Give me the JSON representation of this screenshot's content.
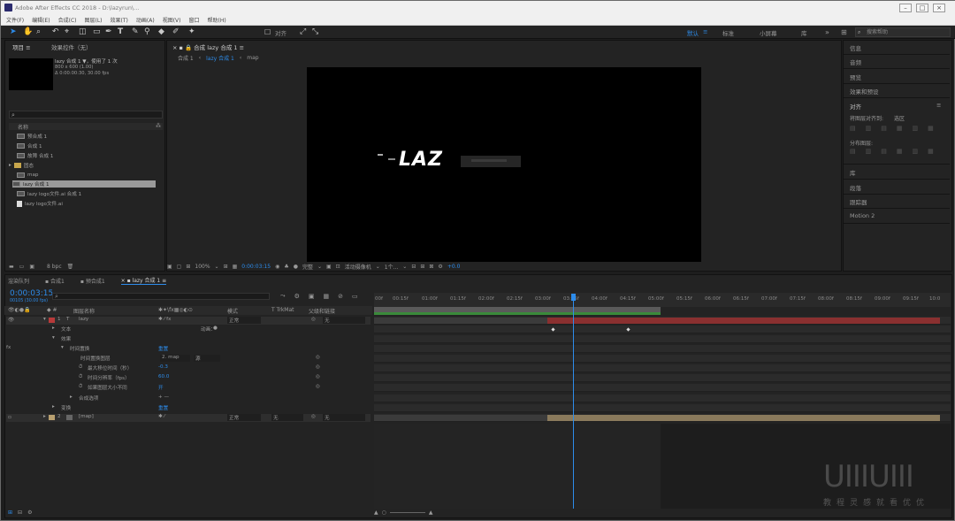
{
  "title_bar": {
    "title": "Adobe After Effects CC 2018 - D:\\lazyrun\\..."
  },
  "menu": [
    "文件(F)",
    "编辑(E)",
    "合成(C)",
    "图层(L)",
    "效果(T)",
    "动画(A)",
    "视图(V)",
    "窗口",
    "帮助(H)"
  ],
  "toolbar": {
    "snap_label": "对齐"
  },
  "workspaces": [
    "默认",
    "标准",
    "小屏幕",
    "库"
  ],
  "search_help": {
    "placeholder": "搜索帮助"
  },
  "project_panel": {
    "tab_project": "项目 ≡",
    "tab_effect_controls": "效果控件（无）",
    "comp_name": "lazy 合成 1 ▼，使用了 1 次",
    "comp_size": "800 x 600 (1.00)",
    "comp_duration": "Δ 0:00:00:30, 30.00 fps",
    "search_placeholder": "",
    "col_name": "名称",
    "items": [
      {
        "name": "预合成 1",
        "icon": "comp"
      },
      {
        "name": "合成 1",
        "icon": "comp"
      },
      {
        "name": "故障 合成 1",
        "icon": "comp"
      },
      {
        "name": "固态",
        "icon": "folder"
      },
      {
        "name": "map",
        "icon": "comp"
      },
      {
        "name": "lazy 合成 1",
        "icon": "comp",
        "selected": true
      },
      {
        "name": "lazy logo文件.ai 合成 1",
        "icon": "comp"
      },
      {
        "name": "lazy logo文件.ai",
        "icon": "file"
      }
    ],
    "bpc": "8 bpc"
  },
  "comp_viewer": {
    "tab_label": "合成 lazy 合成 1",
    "breadcrumb": [
      "合成 1",
      "lazy 合成 1",
      "map"
    ],
    "canvas_text": "LAZ",
    "zoom": "100%",
    "time": "0:00:03:15",
    "resolution": "完整",
    "camera": "活动摄像机",
    "views": "1个...",
    "exposure": "+0.0"
  },
  "right_panel": {
    "items": [
      "信息",
      "音频",
      "预览",
      "效果和预设"
    ],
    "align_title": "对齐",
    "align_to": "将图层对齐到:",
    "align_to_value": "选区",
    "distribute": "分布图层:",
    "items2": [
      "库",
      "段落",
      "跟踪器",
      "Motion 2"
    ]
  },
  "timeline": {
    "timecode": "0:00:03:15",
    "timecode_sub": "00105 (30.00 fps)",
    "tabs": [
      "渲染队列",
      "合成1",
      "预合成1",
      "lazy 合成 1"
    ],
    "col_layer_name": "图层名称",
    "col_mode": "模式",
    "col_trkmat": "T TrkMat",
    "col_parent": "父级和链接",
    "ruler": [
      "00f",
      "00:15f",
      "01:00f",
      "01:15f",
      "02:00f",
      "02:15f",
      "03:00f",
      "03:15f",
      "04:00f",
      "04:15f",
      "05:00f",
      "05:15f",
      "06:00f",
      "06:15f",
      "07:00f",
      "07:15f",
      "08:00f",
      "08:15f",
      "09:00f",
      "09:15f",
      "10:0"
    ],
    "layers": [
      {
        "num": "1",
        "type": "T",
        "name": "lazy",
        "mode": "正常",
        "parent": "无"
      },
      {
        "name": "文本",
        "extra": "动画：",
        "indent": 1
      },
      {
        "name": "效果",
        "indent": 1
      },
      {
        "name": "时间置换",
        "reset": "重置",
        "indent": 2
      },
      {
        "name": "时间置换图层",
        "value": "2. map",
        "value2": "源",
        "indent": 3
      },
      {
        "name": "最大移位时间（秒）",
        "value": "-0.3",
        "indent": 3
      },
      {
        "name": "时间分辨率（fps）",
        "value": "60.0",
        "indent": 3
      },
      {
        "name": "如果图层大小不同",
        "value": "开",
        "indent": 3
      },
      {
        "name": "合成选项",
        "value": "+ —",
        "indent": 2
      },
      {
        "name": "变换",
        "reset": "重置",
        "indent": 1
      },
      {
        "num": "2",
        "name": "[map]",
        "mode": "正常",
        "trkmat": "无",
        "parent": "无"
      }
    ]
  },
  "watermark": {
    "line1": "UIIIUIII",
    "line2": "教程灵感就看优优"
  }
}
